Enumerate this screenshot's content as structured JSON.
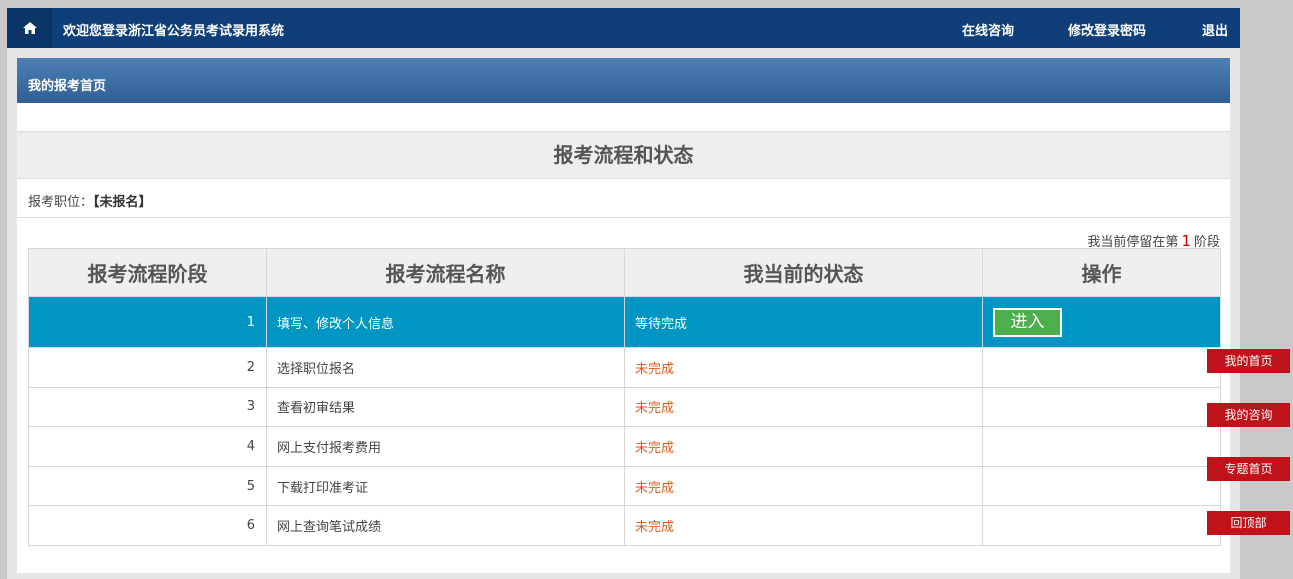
{
  "header": {
    "home_icon": "home-icon",
    "welcome": "欢迎您登录浙江省公务员考试录用系统",
    "nav": [
      "在线咨询",
      "修改登录密码",
      "退出"
    ]
  },
  "panel": {
    "title": "我的报考首页"
  },
  "section": {
    "title": "报考流程和状态"
  },
  "job": {
    "label": "报考职位：",
    "value": "【未报名】"
  },
  "stage_note": {
    "prefix": "我当前停留在第",
    "stage": "1",
    "suffix": "阶段"
  },
  "table": {
    "headers": [
      "报考流程阶段",
      "报考流程名称",
      "我当前的状态",
      "操作"
    ],
    "rows": [
      {
        "stage": "1",
        "name": "填写、修改个人信息",
        "status": "等待完成",
        "action": "进入"
      },
      {
        "stage": "2",
        "name": "选择职位报名",
        "status": "未完成",
        "action": ""
      },
      {
        "stage": "3",
        "name": "查看初审结果",
        "status": "未完成",
        "action": ""
      },
      {
        "stage": "4",
        "name": "网上支付报考费用",
        "status": "未完成",
        "action": ""
      },
      {
        "stage": "5",
        "name": "下载打印准考证",
        "status": "未完成",
        "action": ""
      },
      {
        "stage": "6",
        "name": "网上查询笔试成绩",
        "status": "未完成",
        "action": ""
      }
    ]
  },
  "float_nav": [
    "我的首页",
    "我的咨询",
    "专题首页",
    "回顶部"
  ],
  "colors": {
    "header_bg": "#0f3f78",
    "active_row": "#0096c4",
    "enter_button": "#4cae4c",
    "pending_status": "#e05a1c",
    "float_button": "#c0121b"
  }
}
